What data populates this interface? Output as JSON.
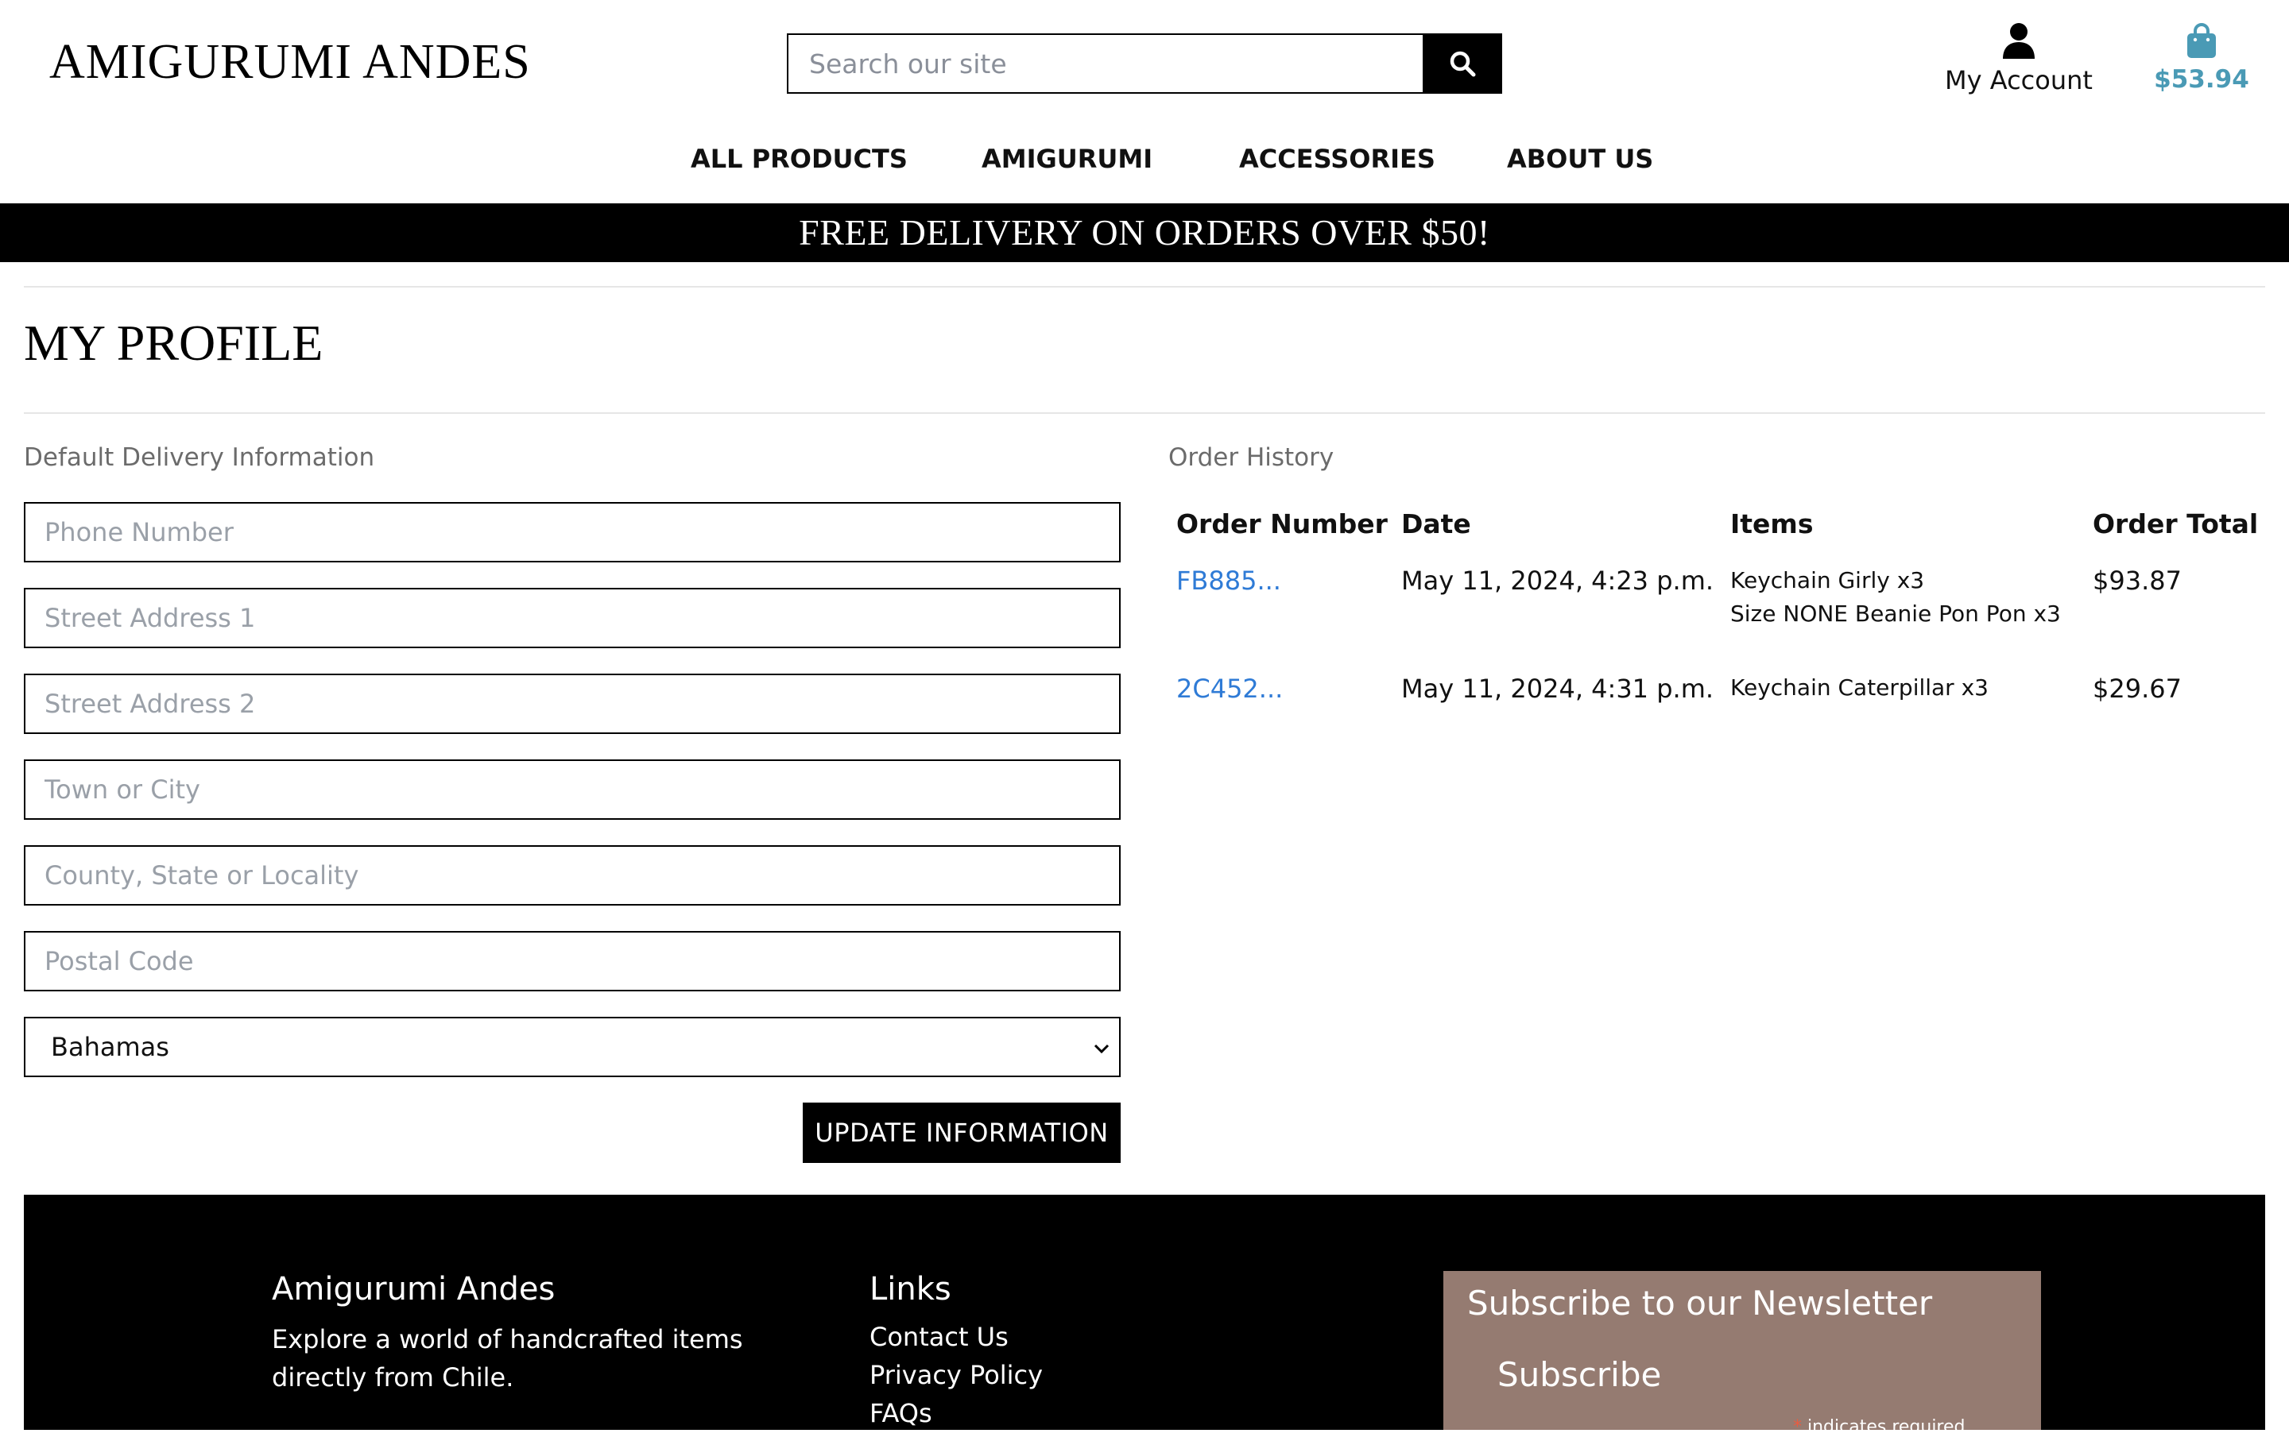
{
  "header": {
    "brand": "AMIGURUMI ANDES",
    "search": {
      "placeholder": "Search our site",
      "value": ""
    },
    "account_label": "My Account",
    "cart_total": "$53.94",
    "colors": {
      "cart": "#4a9ab5"
    }
  },
  "nav": [
    {
      "label": "ALL PRODUCTS"
    },
    {
      "label": "AMIGURUMI"
    },
    {
      "label": "ACCESSORIES"
    },
    {
      "label": "ABOUT US"
    }
  ],
  "banner": "FREE DELIVERY ON ORDERS OVER $50!",
  "page_title": "MY PROFILE",
  "delivery": {
    "heading": "Default Delivery Information",
    "fields": [
      {
        "placeholder": "Phone Number",
        "value": ""
      },
      {
        "placeholder": "Street Address 1",
        "value": ""
      },
      {
        "placeholder": "Street Address 2",
        "value": ""
      },
      {
        "placeholder": "Town or City",
        "value": ""
      },
      {
        "placeholder": "County, State or Locality",
        "value": ""
      },
      {
        "placeholder": "Postal Code",
        "value": ""
      }
    ],
    "country": "Bahamas",
    "submit_label": "UPDATE INFORMATION"
  },
  "orders": {
    "heading": "Order History",
    "columns": [
      "Order Number",
      "Date",
      "Items",
      "Order Total"
    ],
    "rows": [
      {
        "number": "FB885...",
        "date": "May 11, 2024, 4:23 p.m.",
        "items": [
          "Keychain Girly x3",
          "Size NONE Beanie Pon Pon x3"
        ],
        "total": "$93.87"
      },
      {
        "number": "2C452...",
        "date": "May 11, 2024, 4:31 p.m.",
        "items": [
          "Keychain Caterpillar x3"
        ],
        "total": "$29.67"
      }
    ],
    "colors": {
      "link": "#2f7bd6"
    }
  },
  "footer": {
    "about_title": "Amigurumi Andes",
    "about_text": "Explore a world of handcrafted items directly from Chile.",
    "links_title": "Links",
    "links": [
      "Contact Us",
      "Privacy Policy",
      "FAQs"
    ],
    "newsletter": {
      "title": "Subscribe to our Newsletter",
      "subscribe_label": "Subscribe",
      "required_marker": "*",
      "required_note": " indicates required",
      "color": "#957b71"
    }
  }
}
